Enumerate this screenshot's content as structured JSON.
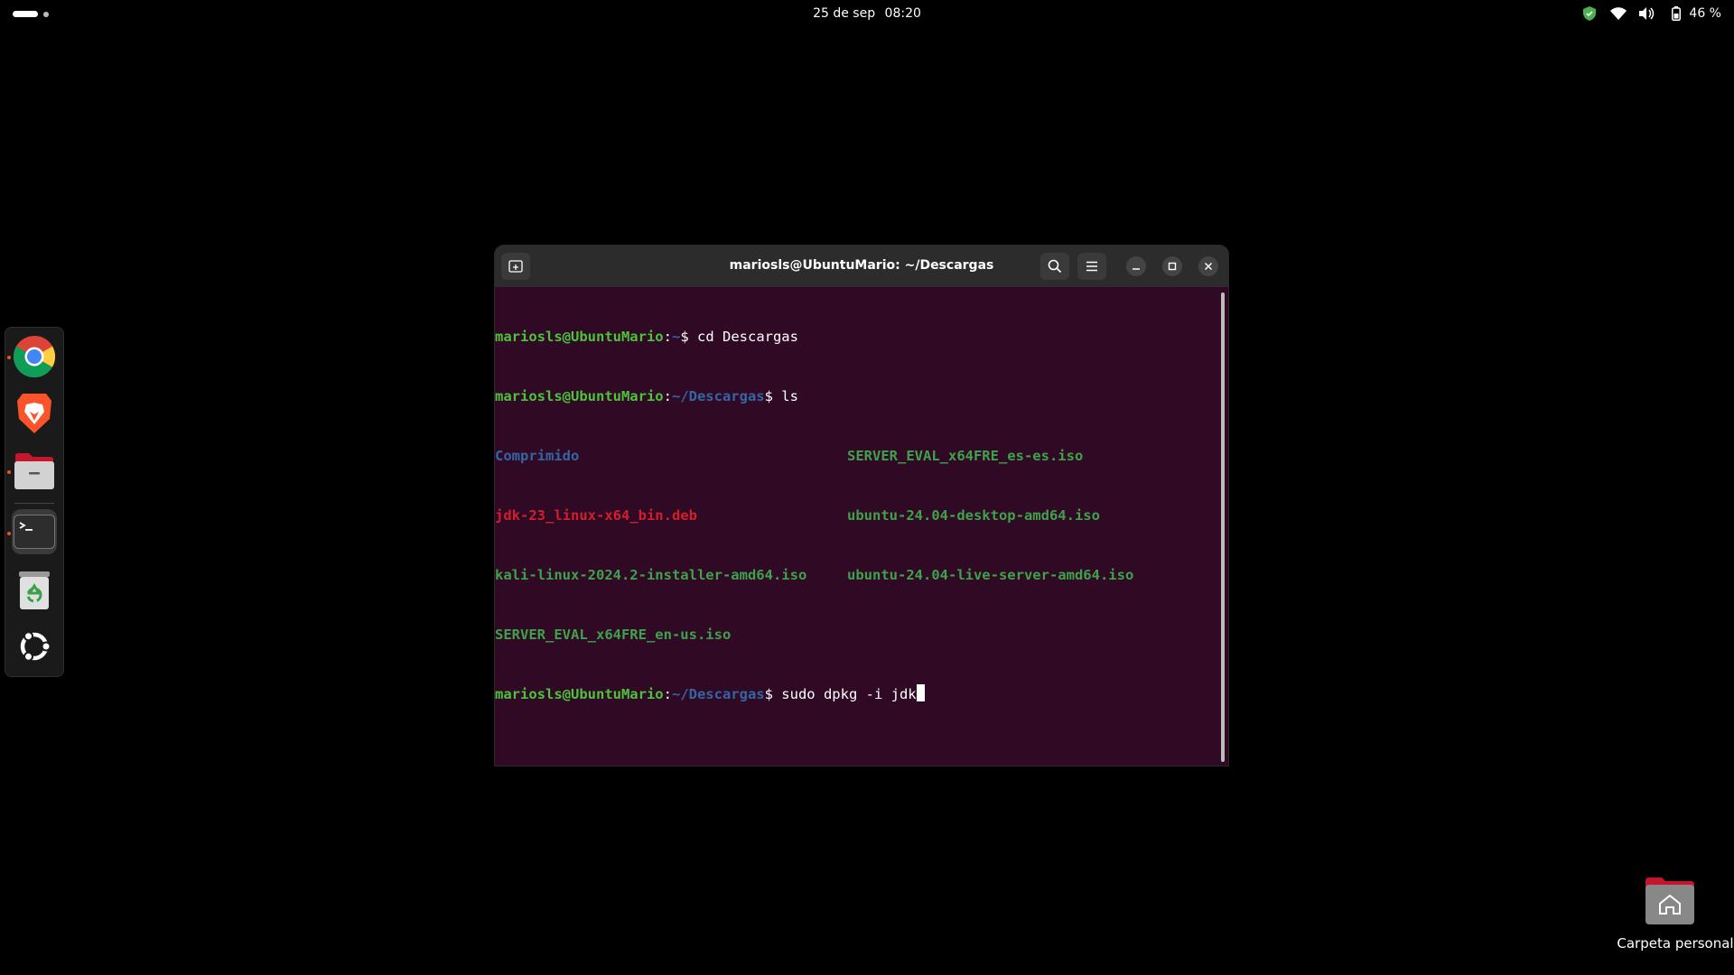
{
  "topbar": {
    "date": "25 de sep",
    "time": "08:20",
    "battery": "46 %",
    "icons": [
      "activities-icon",
      "security-shield-icon",
      "wifi-icon",
      "volume-icon",
      "battery-icon"
    ]
  },
  "dock": {
    "items": [
      {
        "name": "chrome",
        "icon": "chrome-icon",
        "running": true
      },
      {
        "name": "brave",
        "icon": "brave-icon",
        "running": false
      },
      {
        "name": "files",
        "icon": "files-icon",
        "running": true
      },
      {
        "name": "terminal",
        "icon": "terminal-icon",
        "running": true,
        "active": true
      },
      {
        "name": "trash",
        "icon": "trash-icon",
        "running": false
      },
      {
        "name": "ubuntu",
        "icon": "ubuntu-logo-icon",
        "running": false
      }
    ]
  },
  "terminal": {
    "title": "mariosls@UbuntuMario: ~/Descargas",
    "prompt_user": "mariosls@UbuntuMario",
    "prompt_colon": ":",
    "lines": [
      {
        "path": "~",
        "cmd": "$ cd Descargas"
      },
      {
        "path": "~/Descargas",
        "cmd": "$ ls"
      },
      {
        "path": "~/Descargas",
        "cmd": "$ sudo dpkg -i jdk"
      }
    ],
    "ls_output": {
      "col1": [
        "Comprimido",
        "jdk-23_linux-x64_bin.deb",
        "kali-linux-2024.2-installer-amd64.iso",
        "SERVER_EVAL_x64FRE_en-us.iso"
      ],
      "col2": [
        "SERVER_EVAL_x64FRE_es-es.iso",
        "ubuntu-24.04-desktop-amd64.iso",
        "ubuntu-24.04-live-server-amd64.iso"
      ]
    }
  },
  "desktop": {
    "home_folder_label": "Carpeta personal"
  },
  "colors": {
    "terminal_bg": "#300a24",
    "prompt_user": "#4bc33a",
    "prompt_path": "#3465a4",
    "deb_file": "#d11f2c",
    "iso_file": "#3ea24b"
  }
}
